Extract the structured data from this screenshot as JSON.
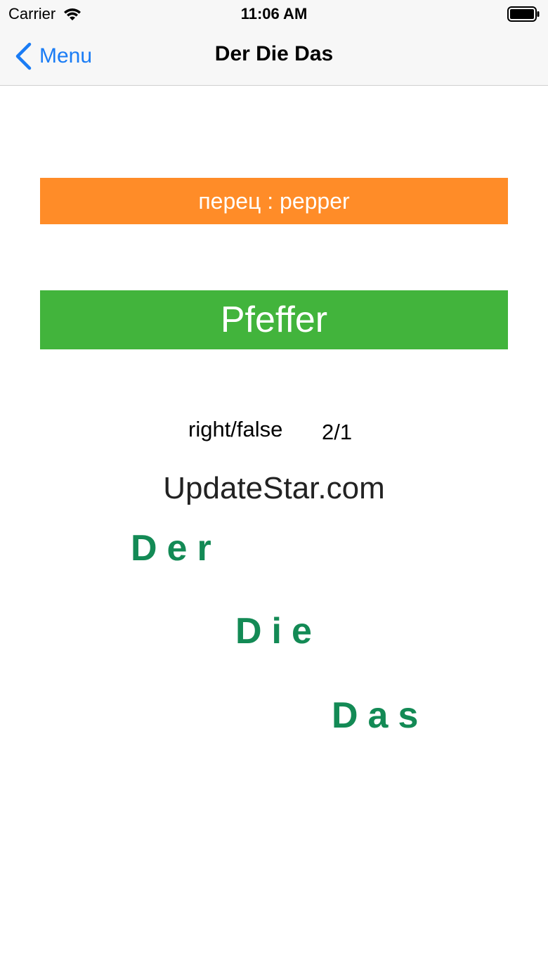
{
  "status_bar": {
    "carrier": "Carrier",
    "time": "11:06 AM",
    "wifi_icon": "wifi-icon",
    "battery_icon": "battery-icon"
  },
  "nav_bar": {
    "back_label": "Menu",
    "back_icon": "chevron-left-icon",
    "title": "Der Die Das",
    "accent_color": "#1a7cf5"
  },
  "quiz": {
    "translation": "перец : pepper",
    "translation_color": "#ff8c28",
    "answer": "Pfeffer",
    "answer_color": "#42b43c",
    "score_label": "right/false",
    "score_value": "2/1",
    "watermark": "UpdateStar.com"
  },
  "articles": {
    "der": "Der",
    "die": "Die",
    "das": "Das",
    "color": "#138a55"
  }
}
